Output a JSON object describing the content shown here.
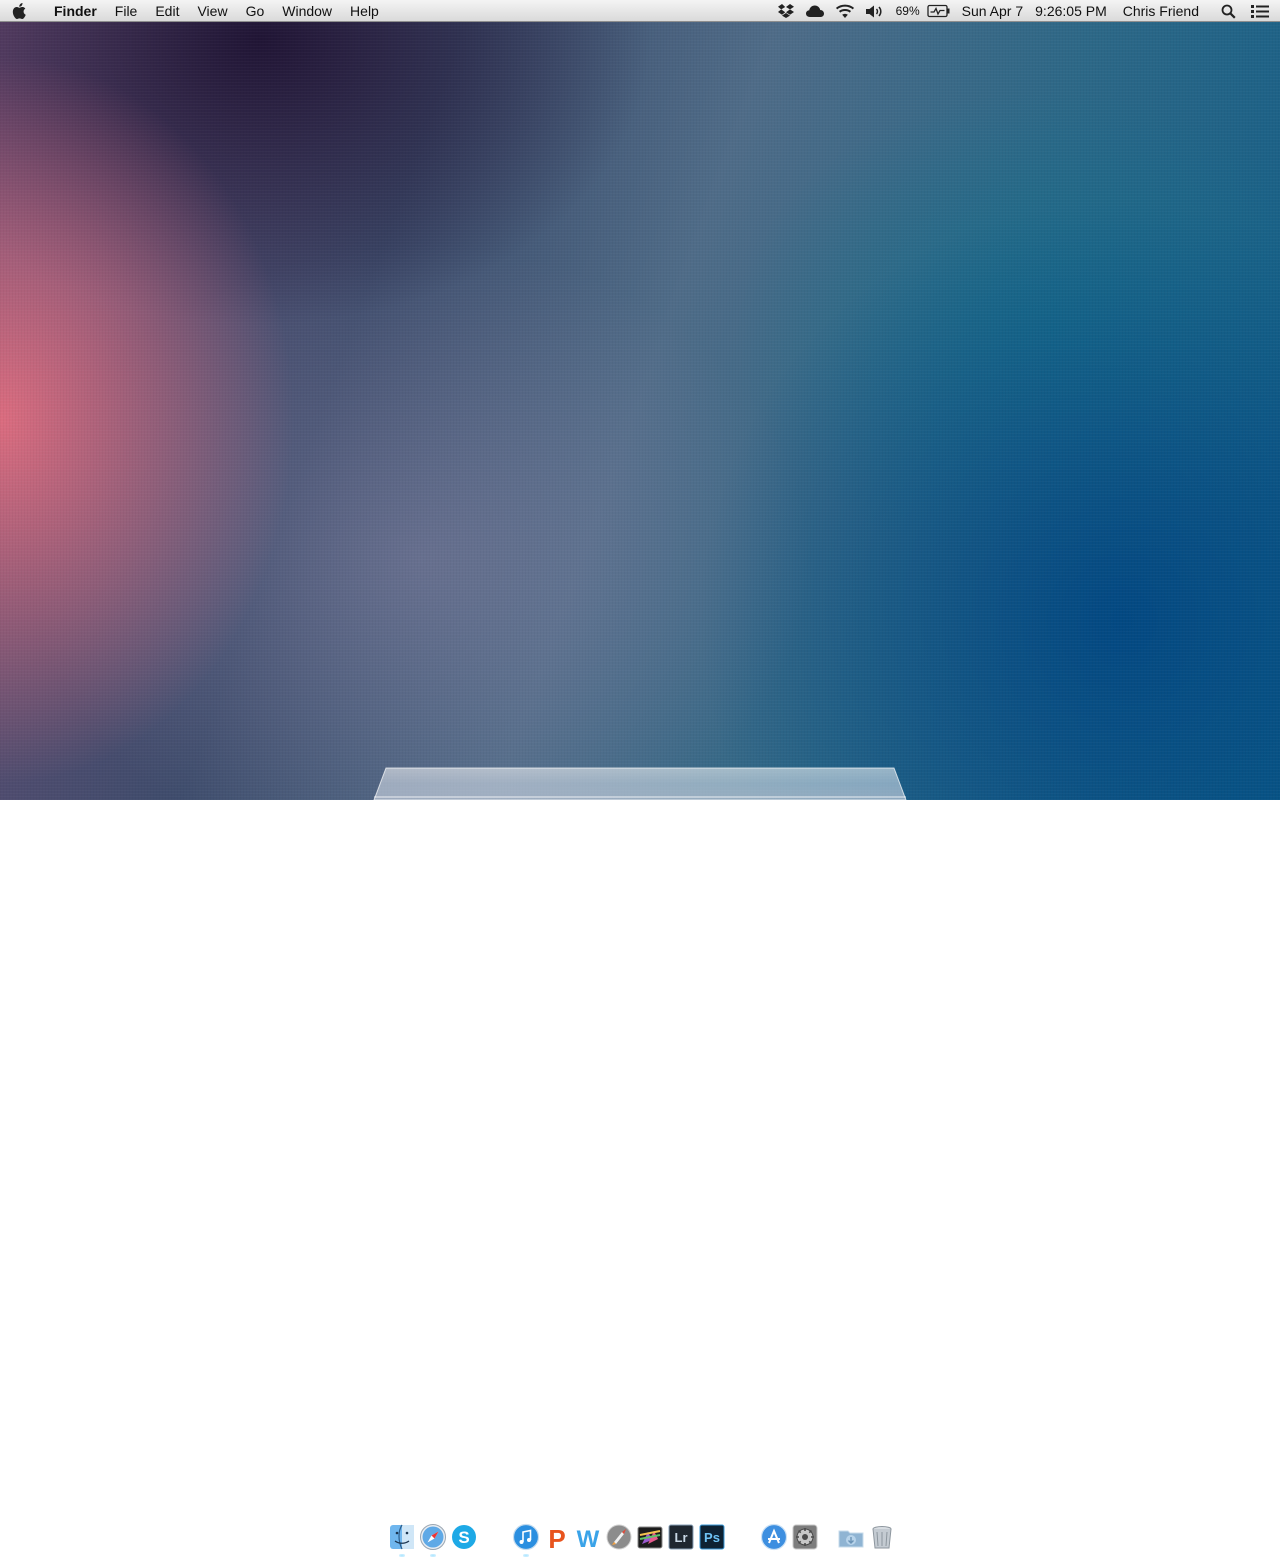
{
  "menubar": {
    "app_name": "Finder",
    "menus": [
      "File",
      "Edit",
      "View",
      "Go",
      "Window",
      "Help"
    ],
    "status": {
      "icons": [
        "dropbox-icon",
        "icloud-icon",
        "wifi-icon",
        "volume-icon"
      ],
      "battery_percent": "69%",
      "date": "Sun Apr 7",
      "time": "9:26:05 PM",
      "user": "Chris Friend",
      "right_icons": [
        "spotlight-search-icon",
        "notification-center-icon"
      ]
    }
  },
  "dock": {
    "apps": [
      {
        "name": "finder-icon",
        "running": true
      },
      {
        "name": "safari-icon",
        "running": true
      },
      {
        "name": "skype-icon",
        "running": false
      },
      {
        "name": "itunes-icon",
        "running": true
      },
      {
        "name": "powerpoint-icon",
        "running": false
      },
      {
        "name": "word-icon",
        "running": false
      },
      {
        "name": "launchpad-icon",
        "running": false
      },
      {
        "name": "final-cut-pro-icon",
        "running": false
      },
      {
        "name": "lightroom-icon",
        "running": false
      },
      {
        "name": "photoshop-icon",
        "running": false
      },
      {
        "name": "app-store-icon",
        "running": false
      },
      {
        "name": "system-preferences-icon",
        "running": false
      },
      {
        "name": "downloads-folder-icon",
        "running": false
      },
      {
        "name": "trash-icon",
        "running": false
      }
    ],
    "labels": {
      "lightroom": "Lr",
      "photoshop": "Ps"
    }
  },
  "colors": {
    "menubar_top": "#f4f4f4",
    "menubar_bottom": "#dadada",
    "wallpaper_pink": "#e26e80",
    "wallpaper_blue": "#0c5b87"
  }
}
